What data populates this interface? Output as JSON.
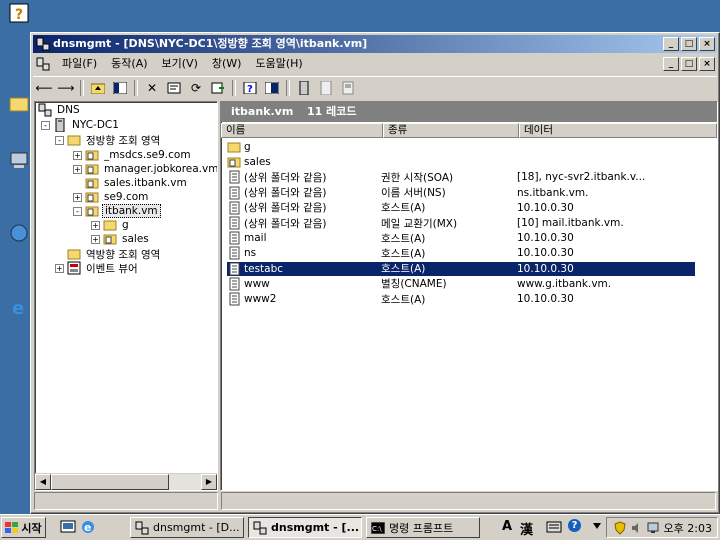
{
  "window": {
    "title": "dnsmgmt - [DNS\\NYC-DC1\\정방향 조회 영역\\itbank.vm]",
    "caption_min": "_",
    "caption_max": "□",
    "caption_close": "×"
  },
  "menu": [
    "파일(F)",
    "동작(A)",
    "보기(V)",
    "창(W)",
    "도움말(H)"
  ],
  "tree": {
    "root": "DNS",
    "server": "NYC-DC1",
    "forward_zones": "정방향 조회 영역",
    "zones": [
      "_msdcs.se9.com",
      "manager.jobkorea.vm",
      "sales.itbank.vm",
      "se9.com",
      "itbank.vm"
    ],
    "itbank_children": [
      "g",
      "sales"
    ],
    "reverse_zones": "역방향 조회 영역",
    "event_viewer": "이벤트 뷰어"
  },
  "pane": {
    "zone": "itbank.vm",
    "record_count": "11 레코드",
    "columns": [
      "이름",
      "종류",
      "데이터"
    ],
    "records": [
      {
        "name": "g",
        "type": "",
        "data": "",
        "icon": "folder"
      },
      {
        "name": "sales",
        "type": "",
        "data": "",
        "icon": "zone-folder"
      },
      {
        "name": "(상위 폴더와 같음)",
        "type": "권한 시작(SOA)",
        "data": "[18], nyc-svr2.itbank.v...",
        "icon": "record"
      },
      {
        "name": "(상위 폴더와 같음)",
        "type": "이름 서버(NS)",
        "data": "ns.itbank.vm.",
        "icon": "record"
      },
      {
        "name": "(상위 폴더와 같음)",
        "type": "호스트(A)",
        "data": "10.10.0.30",
        "icon": "record"
      },
      {
        "name": "(상위 폴더와 같음)",
        "type": "메일 교환기(MX)",
        "data": "[10]  mail.itbank.vm.",
        "icon": "record"
      },
      {
        "name": "mail",
        "type": "호스트(A)",
        "data": "10.10.0.30",
        "icon": "record"
      },
      {
        "name": "ns",
        "type": "호스트(A)",
        "data": "10.10.0.30",
        "icon": "record"
      },
      {
        "name": "testabc",
        "type": "호스트(A)",
        "data": "10.10.0.30",
        "icon": "record"
      },
      {
        "name": "www",
        "type": "별칭(CNAME)",
        "data": "www.g.itbank.vm.",
        "icon": "record"
      },
      {
        "name": "www2",
        "type": "호스트(A)",
        "data": "10.10.0.30",
        "icon": "record"
      }
    ],
    "selected_index": 8
  },
  "taskbar": {
    "start": "시작",
    "tasks": [
      {
        "label": "dnsmgmt - [D...",
        "active": false
      },
      {
        "label": "dnsmgmt - [...",
        "active": true
      },
      {
        "label": "명령 프롬프트",
        "active": false
      }
    ],
    "ime_a": "A",
    "ime_han": "漢",
    "help": "?",
    "clock": "오후 2:03"
  },
  "colors": {
    "desktop": "#3a6ea5",
    "title_start": "#0a246a",
    "selection": "#0a246a"
  }
}
